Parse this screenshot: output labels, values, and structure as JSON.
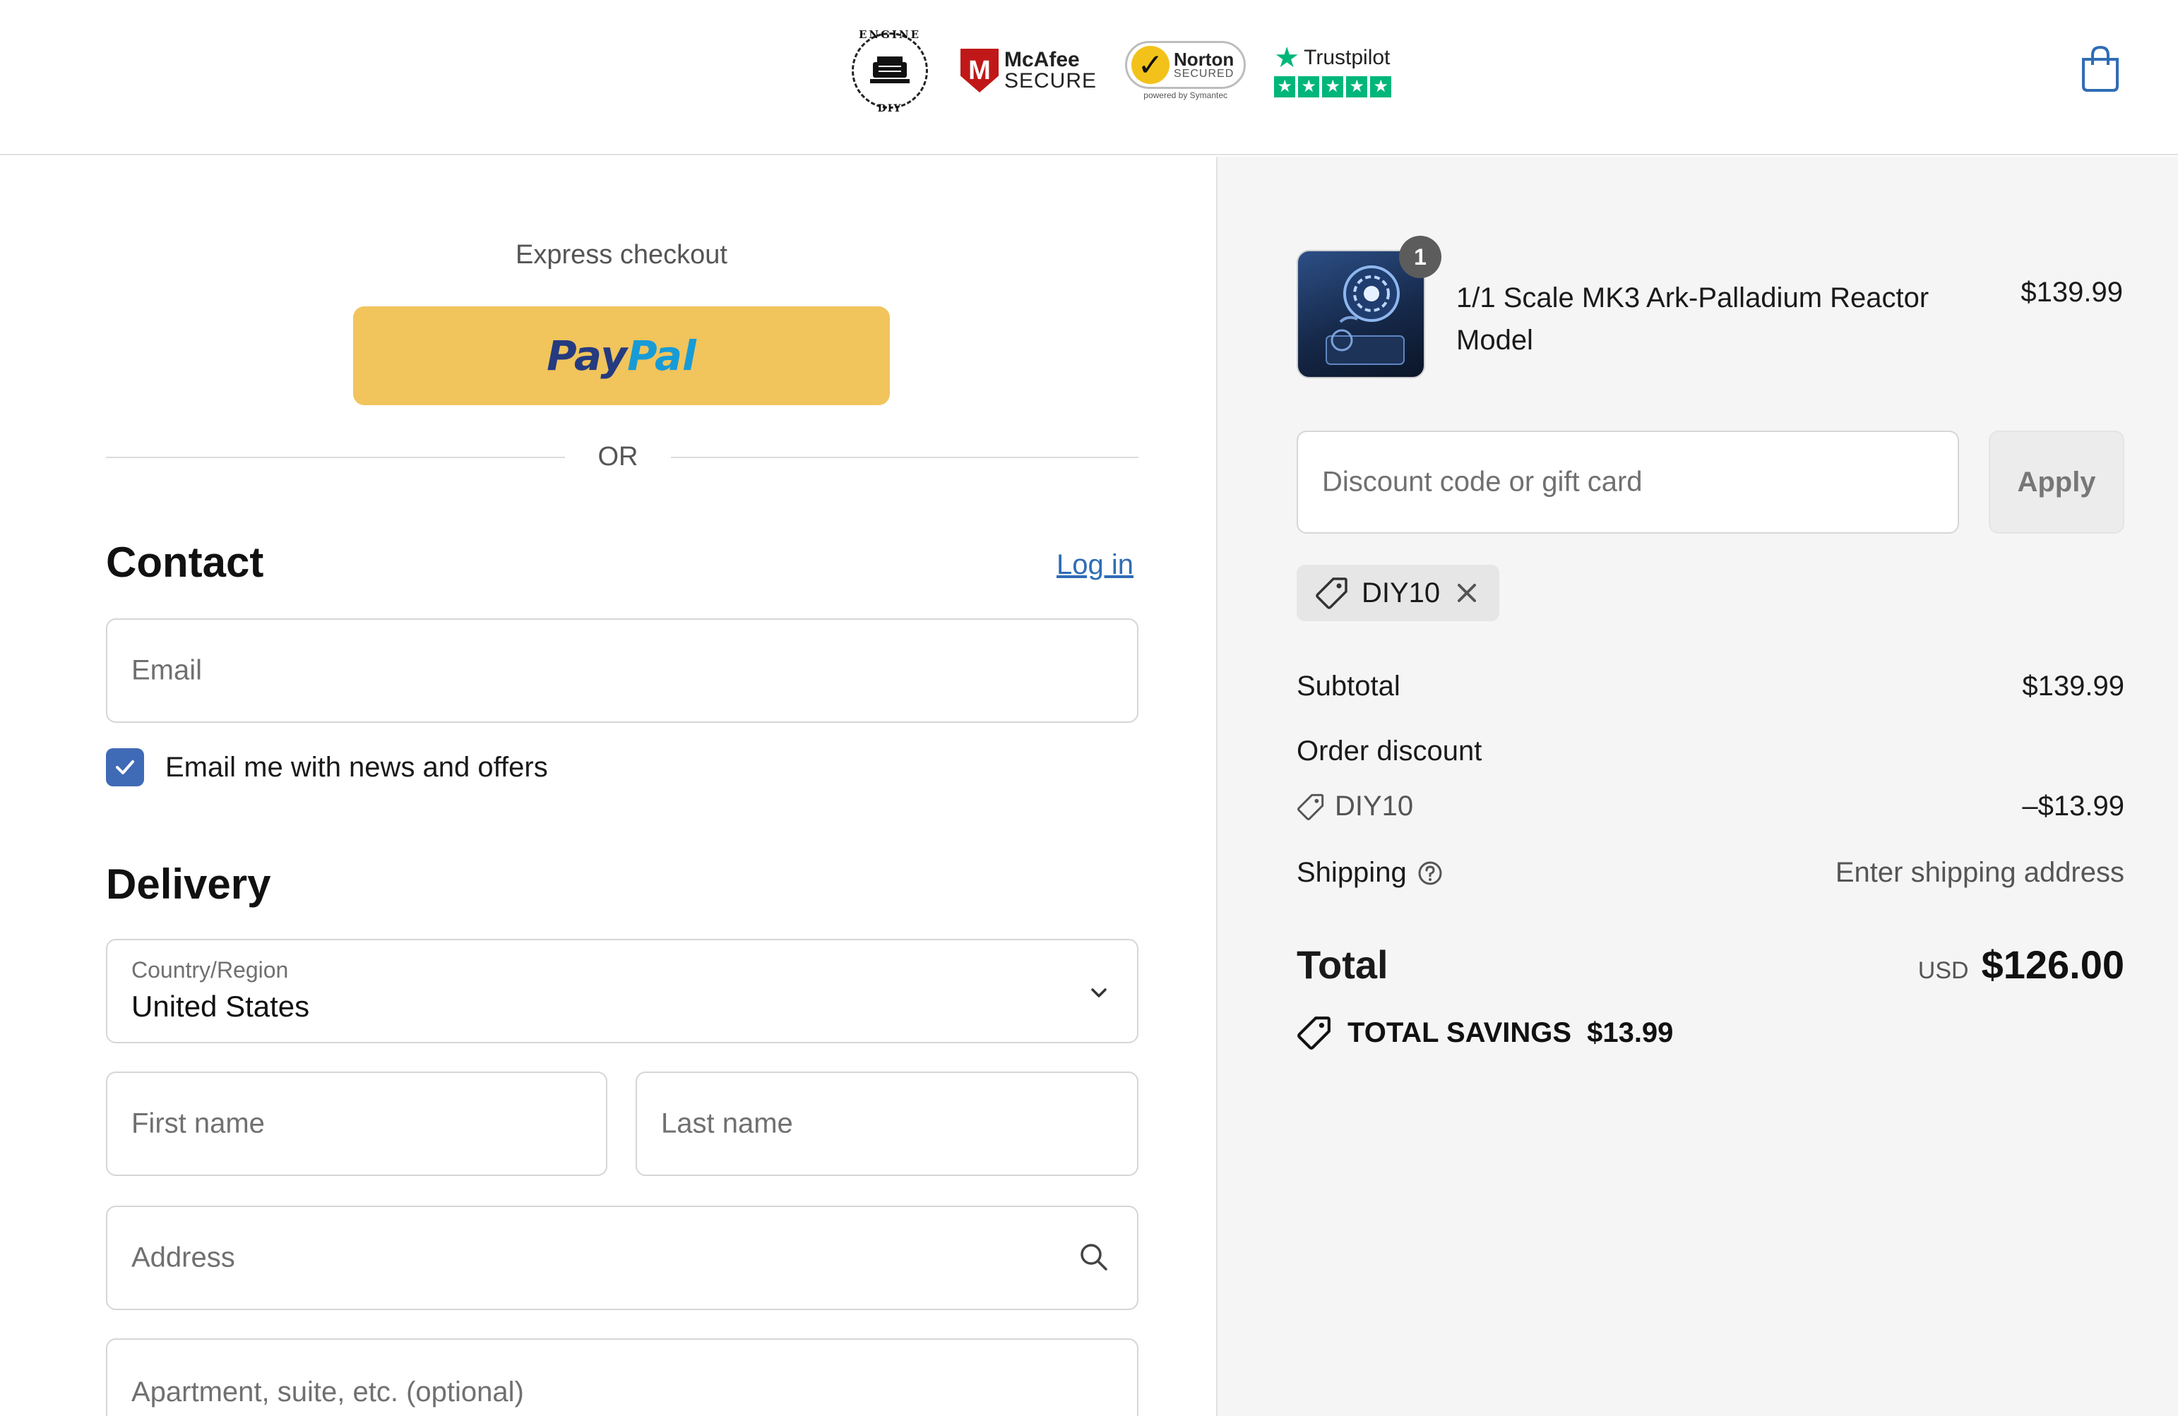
{
  "header": {
    "badges": {
      "engine_top": "ENGINE",
      "engine_bottom": "DIY",
      "mcafee_line1": "McAfee",
      "mcafee_line2": "SECURE",
      "norton_line1": "Norton",
      "norton_line2": "SECURED",
      "norton_sub": "powered by Symantec",
      "trustpilot": "Trustpilot"
    }
  },
  "checkout": {
    "express_title": "Express checkout",
    "paypal_pay": "Pay",
    "paypal_pal": "Pal",
    "or_label": "OR",
    "contact": {
      "heading": "Contact",
      "login_link": "Log in",
      "email_placeholder": "Email",
      "newsletter_label": "Email me with news and offers",
      "newsletter_checked": true
    },
    "delivery": {
      "heading": "Delivery",
      "country_label": "Country/Region",
      "country_value": "United States",
      "first_name_placeholder": "First name",
      "last_name_placeholder": "Last name",
      "address_placeholder": "Address",
      "apartment_placeholder": "Apartment, suite, etc. (optional)"
    }
  },
  "summary": {
    "item": {
      "quantity": "1",
      "name": "1/1 Scale MK3 Ark-Palladium Reactor Model",
      "price": "$139.99"
    },
    "discount_placeholder": "Discount code or gift card",
    "apply_label": "Apply",
    "applied_code": "DIY10",
    "subtotal_label": "Subtotal",
    "subtotal_value": "$139.99",
    "order_discount_label": "Order discount",
    "discount_code": "DIY10",
    "discount_value": "–$13.99",
    "shipping_label": "Shipping",
    "shipping_value": "Enter shipping address",
    "total_label": "Total",
    "currency": "USD",
    "total_value": "$126.00",
    "savings_label": "TOTAL SAVINGS",
    "savings_value": "$13.99"
  },
  "colors": {
    "paypal_yellow": "#f1c45c",
    "link_blue": "#2f6db5",
    "checkbox_blue": "#3f6ab5",
    "summary_bg": "#f5f5f5"
  }
}
